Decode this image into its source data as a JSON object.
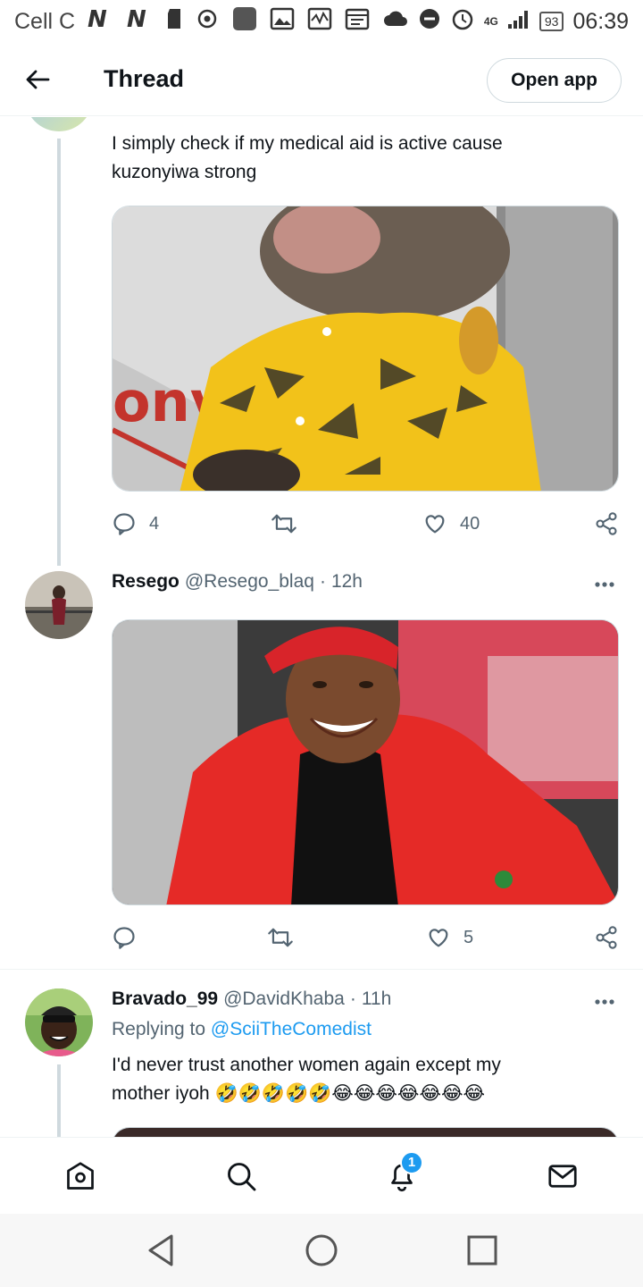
{
  "status_bar": {
    "carrier": "Cell C",
    "network": "4G",
    "battery": "93",
    "time": "06:39"
  },
  "header": {
    "title": "Thread",
    "open_app_label": "Open app"
  },
  "tweets": [
    {
      "text": "I simply check if my medical aid is active  cause kuzonyiwa strong",
      "media_desc": "monkey-in-yellow-shirt",
      "replies": "4",
      "retweets": "",
      "likes": "40"
    },
    {
      "name": "Resego",
      "handle": "@Resego_blaq",
      "time": "12h",
      "media_desc": "man-in-red-jacket-laughing",
      "replies": "",
      "retweets": "",
      "likes": "5"
    },
    {
      "name": "Bravado_99",
      "handle": "@DavidKhaba",
      "time": "11h",
      "replying_prefix": "Replying to",
      "replying_to": "@SciiTheComedist",
      "text_line1": "I'd never trust another women again except my",
      "text_line2": "mother iyoh 🤣🤣🤣🤣🤣😂😂😂😂😂😂😂"
    }
  ],
  "bottom_nav": {
    "notifications_badge": "1"
  },
  "colors": {
    "accent": "#1d9bf0",
    "muted": "#536471",
    "border": "#cfd9de"
  }
}
